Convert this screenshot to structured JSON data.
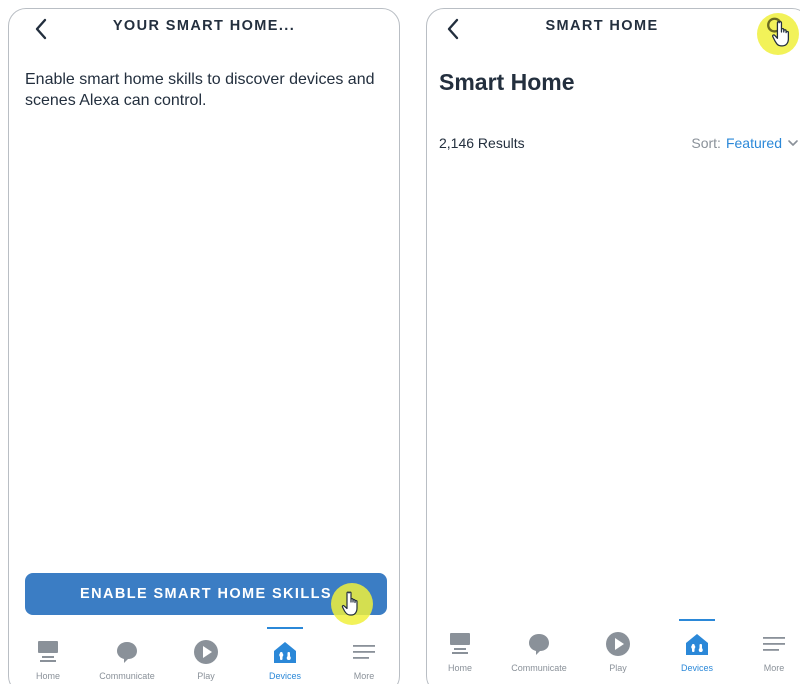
{
  "left_screen": {
    "title": "YOUR SMART HOME...",
    "description": "Enable smart home skills to discover devices and scenes Alexa can control.",
    "enable_button": "ENABLE SMART HOME SKILLS"
  },
  "right_screen": {
    "title": "SMART HOME",
    "heading": "Smart Home",
    "results_count": "2,146 Results",
    "sort_prefix": "Sort:",
    "sort_value": "Featured"
  },
  "nav": {
    "items": [
      {
        "label": "Home",
        "icon": "home-icon"
      },
      {
        "label": "Communicate",
        "icon": "chat-bubble-icon"
      },
      {
        "label": "Play",
        "icon": "play-icon"
      },
      {
        "label": "Devices",
        "icon": "devices-house-icon",
        "active": true
      },
      {
        "label": "More",
        "icon": "menu-lines-icon"
      }
    ]
  },
  "colors": {
    "primary_text": "#232f3e",
    "accent_blue": "#2b88d8",
    "button_blue": "#3b7dc4",
    "inactive_icon": "#8a9199",
    "tap_marker": "#f0f03c"
  }
}
